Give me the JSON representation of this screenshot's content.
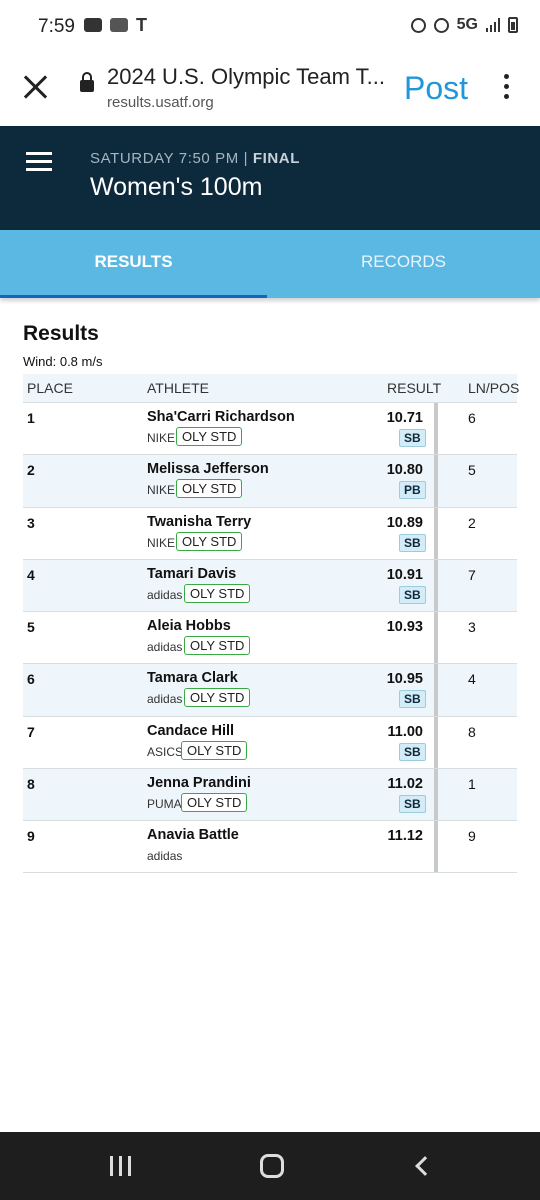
{
  "status_bar": {
    "time": "7:59",
    "network": "5G",
    "icons": [
      "youtube-icon",
      "caller-id-icon",
      "tmobile-icon",
      "battery-saver-icon",
      "alarm-icon",
      "signal-icon",
      "battery-icon"
    ]
  },
  "browser": {
    "title": "2024 U.S. Olympic Team T...",
    "url": "results.usatf.org",
    "post_label": "Post",
    "accent_color": "#2196d9"
  },
  "header": {
    "meta_prefix": "SATURDAY 7:50 PM | ",
    "meta_status": "FINAL",
    "event": "Women's 100m",
    "bg_color": "#0d2a3d"
  },
  "tabs": [
    {
      "label": "RESULTS",
      "active": true
    },
    {
      "label": "RECORDS",
      "active": false
    }
  ],
  "results": {
    "heading": "Results",
    "wind": "Wind: 0.8 m/s",
    "columns": {
      "place": "PLACE",
      "athlete": "ATHLETE",
      "result": "RESULT",
      "lane": "LN/POS"
    },
    "rows": [
      {
        "place": "1",
        "name": "Sha'Carri Richardson",
        "brand": "NIKE",
        "badge": "OLY STD",
        "result": "10.71",
        "record": "SB",
        "lane": "6"
      },
      {
        "place": "2",
        "name": "Melissa Jefferson",
        "brand": "NIKE",
        "badge": "OLY STD",
        "result": "10.80",
        "record": "PB",
        "lane": "5"
      },
      {
        "place": "3",
        "name": "Twanisha Terry",
        "brand": "NIKE",
        "badge": "OLY STD",
        "result": "10.89",
        "record": "SB",
        "lane": "2"
      },
      {
        "place": "4",
        "name": "Tamari Davis",
        "brand": "adidas",
        "badge": "OLY STD",
        "result": "10.91",
        "record": "SB",
        "lane": "7"
      },
      {
        "place": "5",
        "name": "Aleia Hobbs",
        "brand": "adidas",
        "badge": "OLY STD",
        "result": "10.93",
        "record": "",
        "lane": "3"
      },
      {
        "place": "6",
        "name": "Tamara Clark",
        "brand": "adidas",
        "badge": "OLY STD",
        "result": "10.95",
        "record": "SB",
        "lane": "4"
      },
      {
        "place": "7",
        "name": "Candace Hill",
        "brand": "ASICS",
        "badge": "OLY STD",
        "result": "11.00",
        "record": "SB",
        "lane": "8"
      },
      {
        "place": "8",
        "name": "Jenna Prandini",
        "brand": "PUMA",
        "badge": "OLY STD",
        "result": "11.02",
        "record": "SB",
        "lane": "1"
      },
      {
        "place": "9",
        "name": "Anavia Battle",
        "brand": "adidas",
        "badge": "",
        "result": "11.12",
        "record": "",
        "lane": "9"
      }
    ]
  }
}
